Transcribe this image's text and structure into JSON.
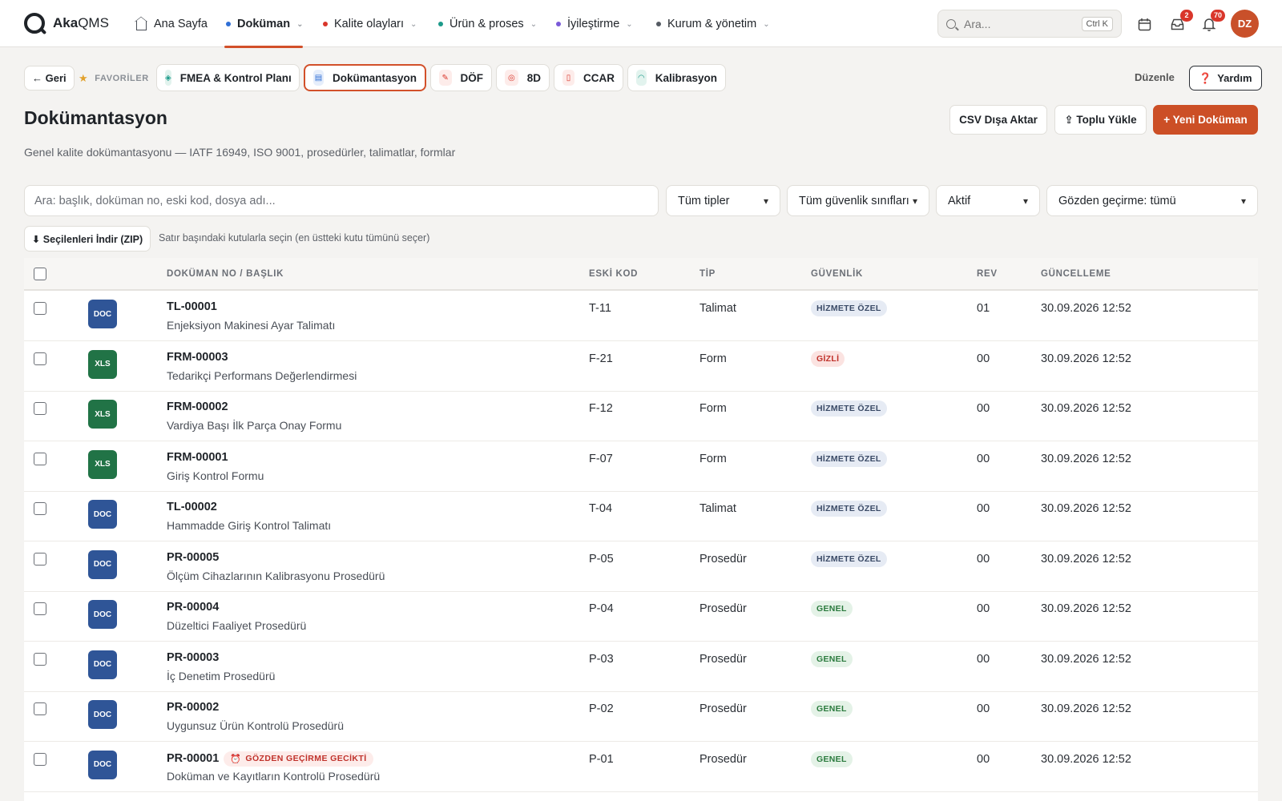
{
  "app": {
    "brand_bold": "Aka",
    "brand_rest": "QMS"
  },
  "nav": {
    "home": "Ana Sayfa",
    "items": [
      {
        "label": "Doküman",
        "color": "#2f6fd6"
      },
      {
        "label": "Kalite olayları",
        "color": "#d9362b"
      },
      {
        "label": "Ürün & proses",
        "color": "#1c9a8a"
      },
      {
        "label": "İyileştirme",
        "color": "#7a5ad8"
      },
      {
        "label": "Kurum & yönetim",
        "color": "#555b63"
      }
    ]
  },
  "search": {
    "placeholder": "Ara...",
    "shortcut": "Ctrl K"
  },
  "notifications": {
    "inbox_count": "2",
    "bell_count": "70"
  },
  "user": {
    "initials": "DZ"
  },
  "favorites": {
    "back": "← Geri",
    "label": "FAVORİLER",
    "chips": [
      "FMEA & Kontrol Planı",
      "Dokümantasyon",
      "DÖF",
      "8D",
      "CCAR",
      "Kalibrasyon"
    ],
    "edit": "Düzenle",
    "help": "Yardım"
  },
  "page": {
    "title": "Dokümantasyon",
    "subtitle": "Genel kalite dokümantasyonu — IATF 16949, ISO 9001, prosedürler, talimatlar, formlar",
    "csv": "CSV Dışa Aktar",
    "bulk": "⇪ Toplu Yükle",
    "new": "+ Yeni Doküman"
  },
  "filters": {
    "search_placeholder": "Ara: başlık, doküman no, eski kod, dosya adı...",
    "type": "Tüm tipler",
    "security": "Tüm güvenlik sınıfları",
    "status": "Aktif",
    "review": "Gözden geçirme: tümü"
  },
  "bulk": {
    "zip": "⬇ Seçilenleri İndir (ZIP)",
    "hint": "Satır başındaki kutularla seçin (en üstteki kutu tümünü seçer)"
  },
  "table": {
    "headers": {
      "doc": "DOKÜMAN NO / BAŞLIK",
      "old": "ESKİ KOD",
      "type": "TİP",
      "security": "GÜVENLİK",
      "rev": "REV",
      "updated": "GÜNCELLEME"
    },
    "rows": [
      {
        "icon": "DOC",
        "no": "TL-00001",
        "title": "Enjeksiyon Makinesi Ayar Talimatı",
        "old": "T-11",
        "type": "Talimat",
        "security": "HİZMETE ÖZEL",
        "rev": "01",
        "updated": "30.09.2026 12:52"
      },
      {
        "icon": "XLS",
        "no": "FRM-00003",
        "title": "Tedarikçi Performans Değerlendirmesi",
        "old": "F-21",
        "type": "Form",
        "security": "GİZLİ",
        "rev": "00",
        "updated": "30.09.2026 12:52"
      },
      {
        "icon": "XLS",
        "no": "FRM-00002",
        "title": "Vardiya Başı İlk Parça Onay Formu",
        "old": "F-12",
        "type": "Form",
        "security": "HİZMETE ÖZEL",
        "rev": "00",
        "updated": "30.09.2026 12:52"
      },
      {
        "icon": "XLS",
        "no": "FRM-00001",
        "title": "Giriş Kontrol Formu",
        "old": "F-07",
        "type": "Form",
        "security": "HİZMETE ÖZEL",
        "rev": "00",
        "updated": "30.09.2026 12:52"
      },
      {
        "icon": "DOC",
        "no": "TL-00002",
        "title": "Hammadde Giriş Kontrol Talimatı",
        "old": "T-04",
        "type": "Talimat",
        "security": "HİZMETE ÖZEL",
        "rev": "00",
        "updated": "30.09.2026 12:52"
      },
      {
        "icon": "DOC",
        "no": "PR-00005",
        "title": "Ölçüm Cihazlarının Kalibrasyonu Prosedürü",
        "old": "P-05",
        "type": "Prosedür",
        "security": "HİZMETE ÖZEL",
        "rev": "00",
        "updated": "30.09.2026 12:52"
      },
      {
        "icon": "DOC",
        "no": "PR-00004",
        "title": "Düzeltici Faaliyet Prosedürü",
        "old": "P-04",
        "type": "Prosedür",
        "security": "GENEL",
        "rev": "00",
        "updated": "30.09.2026 12:52"
      },
      {
        "icon": "DOC",
        "no": "PR-00003",
        "title": "İç Denetim Prosedürü",
        "old": "P-03",
        "type": "Prosedür",
        "security": "GENEL",
        "rev": "00",
        "updated": "30.09.2026 12:52"
      },
      {
        "icon": "DOC",
        "no": "PR-00002",
        "title": "Uygunsuz Ürün Kontrolü Prosedürü",
        "old": "P-02",
        "type": "Prosedür",
        "security": "GENEL",
        "rev": "00",
        "updated": "30.09.2026 12:52"
      },
      {
        "icon": "DOC",
        "no": "PR-00001",
        "title": "Doküman ve Kayıtların Kontrolü Prosedürü",
        "old": "P-01",
        "type": "Prosedür",
        "security": "GENEL",
        "rev": "00",
        "updated": "30.09.2026 12:52",
        "flag": "GÖZDEN GEÇİRME GECİKTİ"
      }
    ]
  }
}
